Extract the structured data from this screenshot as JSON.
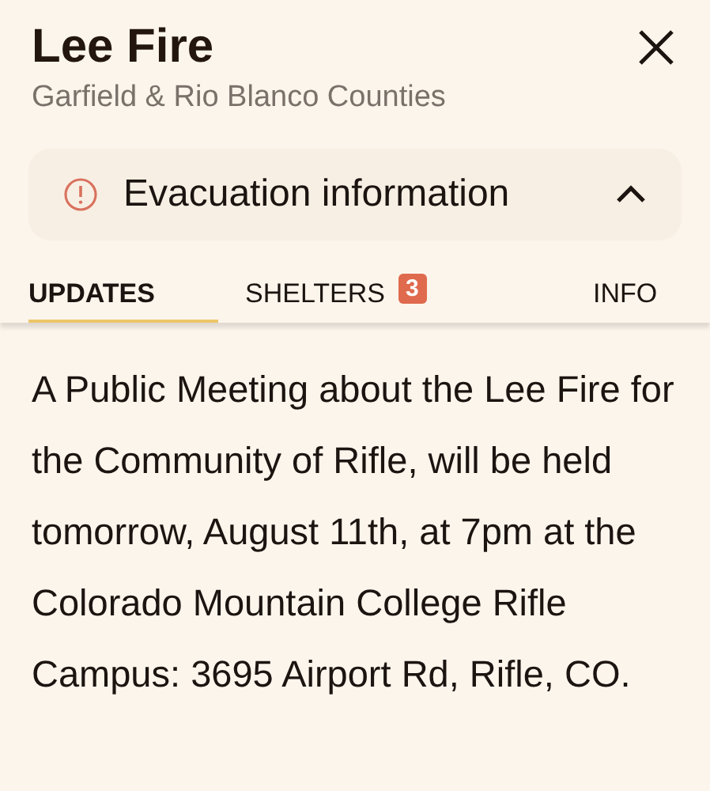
{
  "header": {
    "title": "Lee Fire",
    "subtitle": "Garfield & Rio Blanco Counties"
  },
  "alert": {
    "label": "Evacuation information",
    "expanded": true
  },
  "tabs": [
    {
      "label": "UPDATES",
      "selected": true
    },
    {
      "label": "SHELTERS",
      "selected": false,
      "badge": "3"
    },
    {
      "label": "INFO",
      "selected": false
    }
  ],
  "update": "A Public Meeting about the Lee Fire for the Community of Rifle, will be held tomorrow, August 11th, at 7pm at the Colorado Mountain College Rifle Campus: 3695 Airport Rd, Rifle, CO."
}
